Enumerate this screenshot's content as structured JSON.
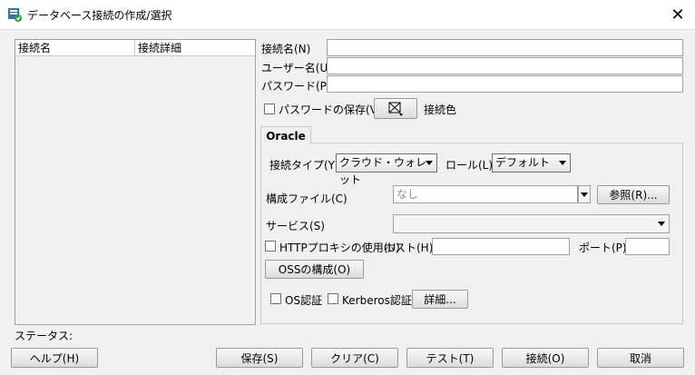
{
  "window": {
    "title": "データベース接続の作成/選択",
    "close_symbol": "✕"
  },
  "list": {
    "columns": [
      "接続名",
      "接続詳細"
    ]
  },
  "form": {
    "conn_name_label": "接続名(N)",
    "username_label": "ユーザー名(U)",
    "password_label": "パスワード(P)",
    "save_password_label": "パスワードの保存(V)",
    "conn_color_label": "接続色"
  },
  "tab": {
    "label": "Oracle"
  },
  "oracle": {
    "conn_type_label": "接続タイプ(Y)",
    "conn_type_value": "クラウド・ウォレット",
    "role_label": "ロール(L)",
    "role_value": "デフォルト",
    "config_file_label": "構成ファイル(C)",
    "config_file_placeholder": "なし",
    "browse_label": "参照(R)...",
    "service_label": "サービス(S)",
    "http_proxy_label": "HTTPプロキシの使用(U)",
    "host_label": "ホスト(H)",
    "port_label": "ポート(P)",
    "oss_config_label": "OSSの構成(O)",
    "os_auth_label": "OS認証",
    "kerberos_label": "Kerberos認証",
    "details_label": "詳細..."
  },
  "status": {
    "label": "ステータス:"
  },
  "buttons": {
    "help": "ヘルプ(H)",
    "save": "保存(S)",
    "clear": "クリア(C)",
    "test": "テスト(T)",
    "connect": "接続(O)",
    "cancel": "取消"
  }
}
